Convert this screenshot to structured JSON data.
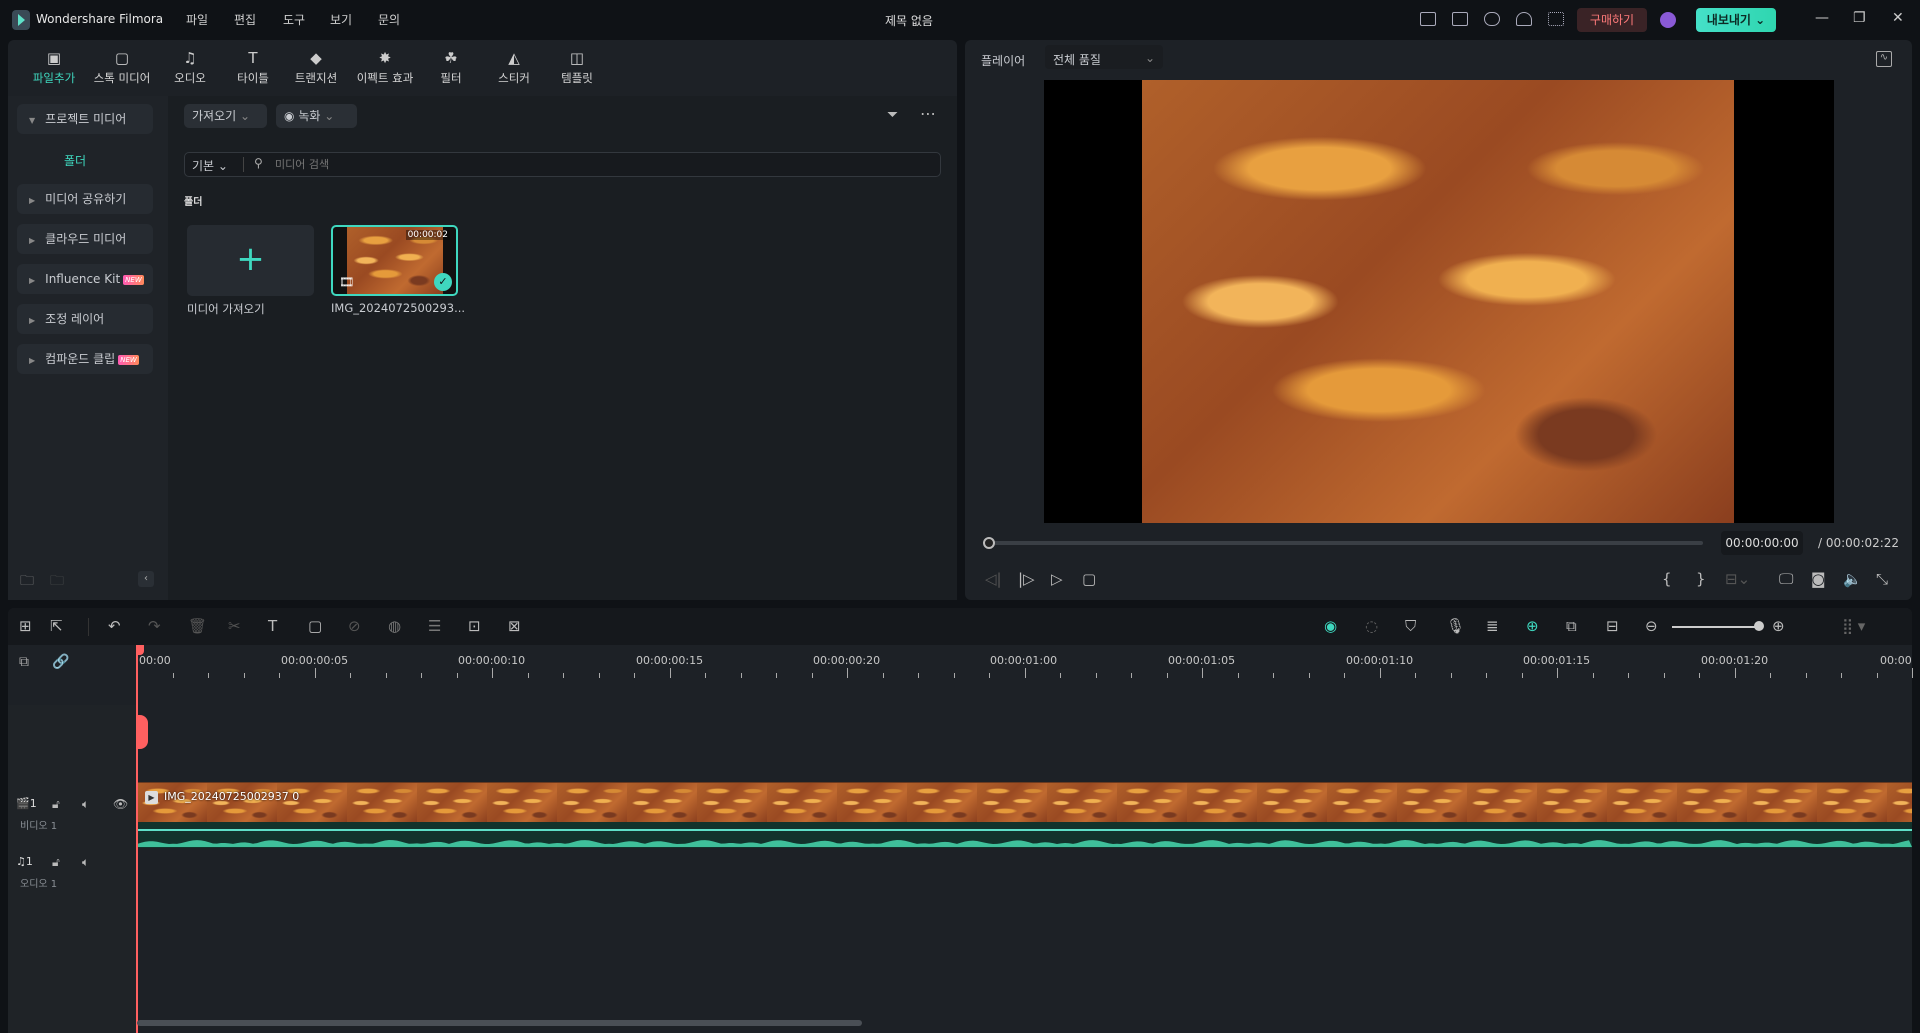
{
  "app": {
    "name": "Wondershare Filmora",
    "doc_title": "제목 없음",
    "menu": [
      "파일",
      "편집",
      "도구",
      "보기",
      "문의"
    ],
    "buy": "구매하기",
    "export": "내보내기",
    "accent": "#3fd8bf"
  },
  "toolbar": {
    "tabs": [
      "파일추가",
      "스톡 미디어",
      "오디오",
      "타이틀",
      "트랜지션",
      "이펙트 효과",
      "필터",
      "스티커",
      "템플릿"
    ],
    "active": 0
  },
  "sidebar": {
    "project_media": "프로젝트 미디어",
    "folder": "폴더",
    "items": [
      {
        "label": "미디어 공유하기"
      },
      {
        "label": "클라우드 미디어"
      },
      {
        "label": "Influence Kit",
        "badge": "NEW"
      },
      {
        "label": "조정 레이어"
      },
      {
        "label": "컴파운드 클립",
        "badge": "NEW"
      }
    ]
  },
  "media": {
    "import": "가져오기",
    "record": "녹화",
    "sort": "기본",
    "search_placeholder": "미디어 검색",
    "section": "폴더",
    "add_label": "미디어 가져오기",
    "clip_name": "IMG_2024072500293...",
    "clip_duration": "00:00:02"
  },
  "player": {
    "label": "플레이어",
    "quality": "전체 품질",
    "current": "00:00:00:00",
    "total": "/ 00:00:02:22",
    "progress": 0
  },
  "timeline": {
    "ruler": [
      "00:00",
      "00:00:00:05",
      "00:00:00:10",
      "00:00:00:15",
      "00:00:00:20",
      "00:00:01:00",
      "00:00:01:05",
      "00:00:01:10",
      "00:00:01:15",
      "00:00:01:20",
      "00:00"
    ],
    "video_track": {
      "num": "1",
      "name": "비디오 1"
    },
    "audio_track": {
      "num": "1",
      "name": "오디오 1"
    },
    "clip_label": "IMG_20240725002937 0",
    "zoom_level": 0.95
  }
}
